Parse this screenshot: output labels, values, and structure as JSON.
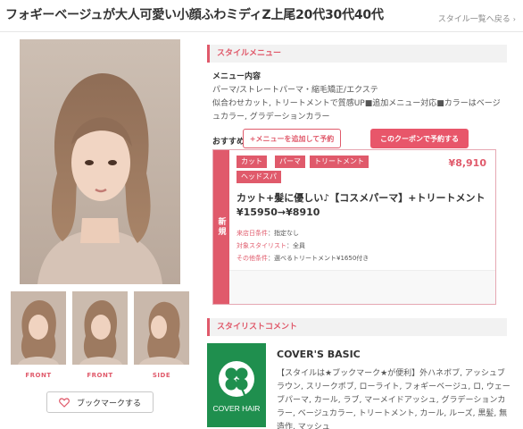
{
  "header": {
    "title": "フォギーベージュが大人可愛い小顔ふわミディZ上尾20代30代40代",
    "back_link": "スタイル一覧へ戻る"
  },
  "gallery": {
    "thumbnails": [
      {
        "label": "FRONT"
      },
      {
        "label": "FRONT"
      },
      {
        "label": "SIDE"
      }
    ],
    "bookmark_label": "ブックマークする"
  },
  "style_menu": {
    "heading": "スタイルメニュー",
    "menu_label": "メニュー内容",
    "menu_lines": [
      "パーマ/ストレートパーマ・縮毛矯正/エクステ",
      "似合わせカット, トリートメントで質感UP■追加メニュー対応■カラーはベージ",
      "ュカラー, グラデーションカラー"
    ],
    "coupon_label": "おすすめクーポン"
  },
  "coupon": {
    "side_label": "新規",
    "tags": [
      "カット",
      "パーマ",
      "トリートメント",
      "ヘッドスパ"
    ],
    "price": "¥8,910",
    "title_line1": "カット+髪に優しい♪【コスメパーマ】+トリートメント",
    "title_line2": "¥15950→¥8910",
    "conditions": [
      {
        "key": "来店日条件",
        "value": "：指定なし"
      },
      {
        "key": "対象スタイリスト",
        "value": "：全員"
      },
      {
        "key": "その他条件",
        "value": "：選べるトリートメント¥1650付き"
      }
    ],
    "add_menu_button": "+メニューを追加して予約",
    "reserve_button": "このクーポンで予約する"
  },
  "stylist": {
    "heading": "スタイリストコメント",
    "logo_text": "COVER HAIR",
    "salon_name": "COVER'S BASIC",
    "comment_lines": [
      "【スタイルは★ブックマーク★が便利】外ハネボブ, アッシュブ",
      "ラウン, スリークボブ, ローライト, フォギーベージュ, ロ, ウェー",
      "ブパーマ, カール, ラブ, マーメイドアッシュ, グラデーションカ",
      "ラー, ベージュカラー, トリートメント, カール, ルーズ, 黒髪, 無",
      "造作, マッシュ"
    ]
  },
  "colors": {
    "accent": "#e05a6b",
    "logo_green": "#1f8f4e"
  }
}
